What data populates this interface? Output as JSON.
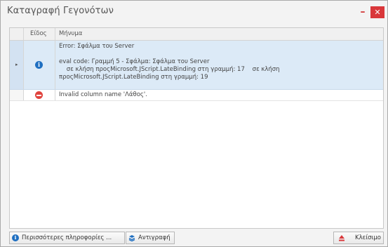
{
  "window": {
    "title": "Καταγραφή Γεγονότων",
    "minimize_glyph": "–",
    "close_glyph": "✕",
    "accent_color": "#d9373a"
  },
  "grid": {
    "columns": [
      "Είδος",
      "Μήνυμα"
    ],
    "rows": [
      {
        "icon": "info-icon",
        "selected": true,
        "lines": [
          "Error: Σφάλμα του Server",
          "",
          "eval code: Γραμμή 5 - Σφάλμα: Σφάλμα του Server",
          "    σε κλήση προςMicrosoft.JScript.LateBinding στη γραμμή: 17    σε κλήση",
          "προςMicrosoft.JScript.LateBinding στη γραμμή: 19"
        ]
      },
      {
        "icon": "error-icon",
        "selected": false,
        "lines": [
          "Invalid column name 'Λάθος'."
        ]
      }
    ]
  },
  "buttons": {
    "more_info": "Περισσότερες πληροφορίες ...",
    "copy": "Αντιγραφή",
    "close": "Κλείσιμο"
  }
}
